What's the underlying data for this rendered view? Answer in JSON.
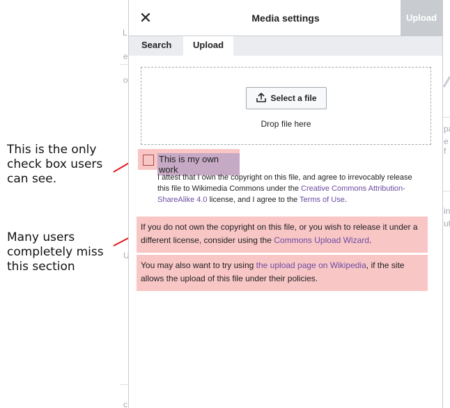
{
  "dialog": {
    "title": "Media settings",
    "close_glyph": "✕",
    "upload_label": "Upload"
  },
  "tabs": [
    {
      "label": "Search",
      "active": false
    },
    {
      "label": "Upload",
      "active": true
    }
  ],
  "dropzone": {
    "select_label": "Select a file",
    "drop_text": "Drop file here",
    "icon": "upload-icon"
  },
  "own_work": {
    "label": "This is my own work",
    "checked": false
  },
  "attest": {
    "part1": "I attest that I own the copyright on this file, and agree to irrevocably release this file to Wikimedia Commons under the ",
    "license_link": "Creative Commons Attribution-ShareAlike 4.0",
    "part2": " license, and I agree to the ",
    "terms_link": "Terms of Use",
    "part3": "."
  },
  "alt_options": {
    "p1_text": "If you do not own the copyright on this file, or you wish to release it under a different license, consider using the ",
    "p1_link": "Commons Upload Wizard",
    "p1_end": ".",
    "p2_text": "You may also want to try using ",
    "p2_link": "the upload page on Wikipedia",
    "p2_end": ", if the site allows the upload of this file under their policies."
  },
  "annotations": {
    "top_line1": "This is the only",
    "top_line2": "check box users",
    "top_line3": "can see.",
    "bottom_line1": "Many users",
    "bottom_line2": "completely miss",
    "bottom_line3": "this section"
  },
  "background_fragments": [
    "L",
    "e",
    "o",
    "pa",
    "e f",
    "in",
    "ut",
    "U",
    "c"
  ],
  "colors": {
    "highlight_pink": "#f9c6c6",
    "label_highlight": "#c6a9c4",
    "link": "#6b4ba1",
    "arrow_red": "#e0161c",
    "disabled_button": "#c8ccd1"
  }
}
